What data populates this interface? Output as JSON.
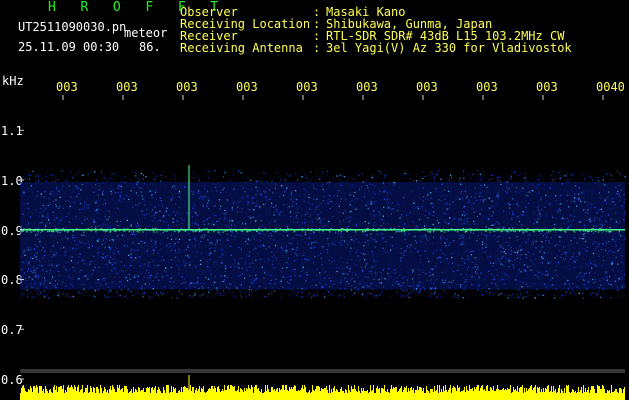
{
  "header": {
    "app_title": "H R O F F T",
    "file_name": "UT2511090030.pn",
    "detection_label": "meteor",
    "datetime": "25.11.09 00:30",
    "count": "86."
  },
  "station": [
    {
      "label": "Observer",
      "sep": ":",
      "value": "Masaki Kano"
    },
    {
      "label": "Receiving Location",
      "sep": ":",
      "value": "Shibukawa, Gunma, Japan"
    },
    {
      "label": "Receiver",
      "sep": ":",
      "value": "RTL-SDR SDR# 43dB L15 103.2MHz CW"
    },
    {
      "label": "Receiving Antenna",
      "sep": ":",
      "value": "3el Yagi(V) Az 330 for Vladivostok"
    }
  ],
  "spectrogram": {
    "unit_label": "kHz",
    "time_ticks": [
      "003",
      "003",
      "003",
      "003",
      "003",
      "003",
      "003",
      "003",
      "003",
      "0040"
    ],
    "freq_ticks": [
      "1.1",
      "1.0",
      "0.9",
      "0.8",
      "0.7",
      "0.6"
    ],
    "freq_range_khz": [
      0.6,
      1.15
    ],
    "carrier_khz": 0.9,
    "noise_band_khz": [
      0.78,
      1.0
    ],
    "meteor_streak_khz": [
      0.9,
      1.03
    ]
  },
  "colors": {
    "background": "#000000",
    "title": "#22ee22",
    "header_text": "#ffffff",
    "station_text": "#ffff55",
    "tick_text": "#ffff55",
    "noise_dark": "#0a1a78",
    "noise_mid": "#1f4cff",
    "noise_bright": "#48b4ff",
    "carrier": "#44ff88",
    "amplitude": "#ffff00",
    "axis_tick": "#cfcfcf"
  }
}
